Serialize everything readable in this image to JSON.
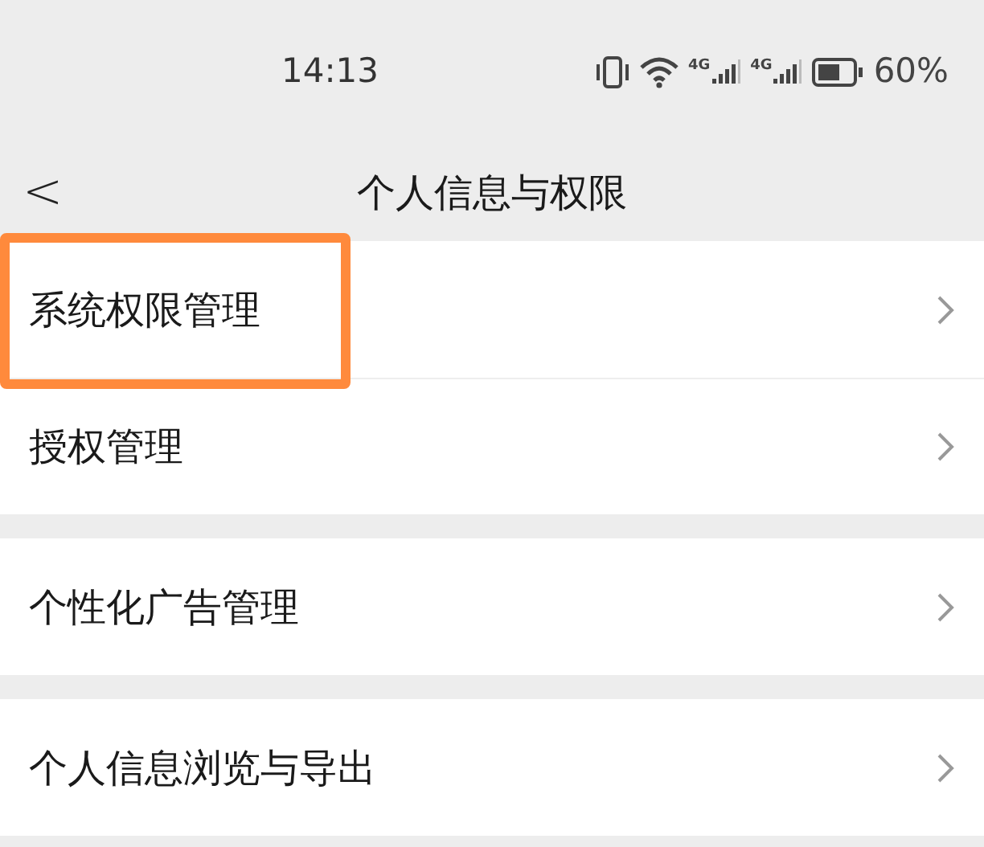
{
  "status_bar": {
    "time": "14:13",
    "networks": [
      "4G",
      "4G"
    ],
    "battery": "60%"
  },
  "header": {
    "back": "<",
    "title": "个人信息与权限"
  },
  "sections": [
    {
      "items": [
        {
          "label": "系统权限管理",
          "highlighted": true
        },
        {
          "label": "授权管理",
          "highlighted": false
        }
      ]
    },
    {
      "items": [
        {
          "label": "个性化广告管理",
          "highlighted": false
        }
      ]
    },
    {
      "items": [
        {
          "label": "个人信息浏览与导出",
          "highlighted": false
        }
      ]
    }
  ]
}
